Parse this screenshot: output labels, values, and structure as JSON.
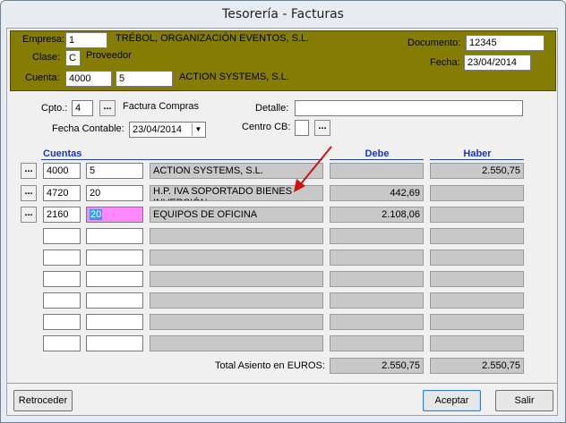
{
  "window": {
    "title": "Tesorería - Facturas"
  },
  "header": {
    "empresa_label": "Empresa:",
    "empresa_value": "1",
    "empresa_name": "TRÉBOL, ORGANIZACIÓN EVENTOS, S.L.",
    "clase_label": "Clase:",
    "clase_value": "C",
    "clase_name": "Proveedor",
    "cuenta_label": "Cuenta:",
    "cuenta_value": "4000",
    "cuenta_sub": "5",
    "cuenta_name": "ACTION SYSTEMS, S.L.",
    "documento_label": "Documento:",
    "documento_value": "12345",
    "fecha_label": "Fecha:",
    "fecha_value": "23/04/2014",
    "header_color": "#857c03"
  },
  "form": {
    "cpto_label": "Cpto.:",
    "cpto_value": "4",
    "cpto_name": "Factura Compras",
    "detalle_label": "Detalle:",
    "detalle_value": "",
    "fecha_contable_label": "Fecha Contable:",
    "fecha_contable_value": "23/04/2014",
    "centro_label": "Centro CB:",
    "centro_value": ""
  },
  "grid": {
    "col_cuentas": "Cuentas",
    "col_debe": "Debe",
    "col_haber": "Haber",
    "rows": [
      {
        "cuenta": "4000",
        "sub": "5",
        "desc": "ACTION SYSTEMS, S.L.",
        "debe": "",
        "haber": "2.550,75"
      },
      {
        "cuenta": "4720",
        "sub": "20",
        "desc": "H.P. IVA SOPORTADO BIENES INVERSIÓN",
        "debe": "442,69",
        "haber": ""
      },
      {
        "cuenta": "2160",
        "sub": "20",
        "desc": "EQUIPOS DE OFICINA",
        "debe": "2.108,06",
        "haber": ""
      }
    ],
    "ellipsis": "...",
    "total_label": "Total Asiento en EUROS:",
    "total_debe": "2.550,75",
    "total_haber": "2.550,75",
    "highlight_color": "#ff88ff",
    "arrow_color": "#cc1111"
  },
  "footer": {
    "retroceder": "Retroceder",
    "aceptar": "Aceptar",
    "salir": "Salir"
  }
}
